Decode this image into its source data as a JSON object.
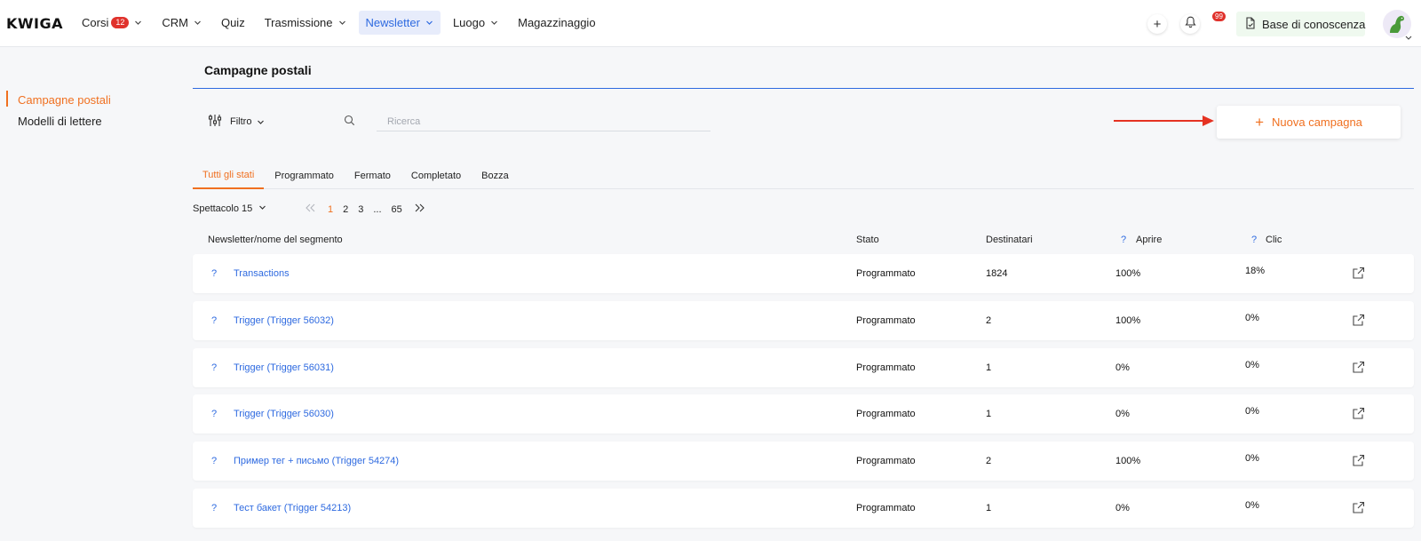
{
  "brand": {
    "logo": "KWIGA"
  },
  "nav": [
    {
      "label": "Corsi",
      "badge": "12",
      "has_dropdown": true,
      "active": false
    },
    {
      "label": "CRM",
      "badge": null,
      "has_dropdown": true,
      "active": false
    },
    {
      "label": "Quiz",
      "badge": null,
      "has_dropdown": false,
      "active": false
    },
    {
      "label": "Trasmissione",
      "badge": null,
      "has_dropdown": true,
      "active": false
    },
    {
      "label": "Newsletter",
      "badge": null,
      "has_dropdown": true,
      "active": true
    },
    {
      "label": "Luogo",
      "badge": null,
      "has_dropdown": true,
      "active": false
    },
    {
      "label": "Magazzinaggio",
      "badge": null,
      "has_dropdown": false,
      "active": false
    }
  ],
  "header_actions": {
    "add_label": "+",
    "notifications_badge": "99",
    "knowledge_base_label": "Base di conoscenza"
  },
  "sidebar": {
    "items": [
      {
        "label": "Campagne postali",
        "active": true
      },
      {
        "label": "Modelli di lettere",
        "active": false
      }
    ]
  },
  "page": {
    "title": "Campagne postali",
    "filter_label": "Filtro",
    "search_placeholder": "Ricerca",
    "search_value": "",
    "new_campaign_label": "Nuova campagna",
    "new_campaign_plus": "+"
  },
  "tabs": [
    {
      "label": "Tutti gli stati",
      "active": true
    },
    {
      "label": "Programmato",
      "active": false
    },
    {
      "label": "Fermato",
      "active": false
    },
    {
      "label": "Completato",
      "active": false
    },
    {
      "label": "Bozza",
      "active": false
    }
  ],
  "pagination": {
    "per_page_label": "Spettacolo 15",
    "pages": [
      {
        "label": "1",
        "active": true
      },
      {
        "label": "2",
        "active": false
      },
      {
        "label": "3",
        "active": false
      },
      {
        "label": "...",
        "active": false
      },
      {
        "label": "65",
        "active": false
      }
    ]
  },
  "table": {
    "columns": {
      "name": "Newsletter/nome del segmento",
      "status": "Stato",
      "recipients": "Destinatari",
      "open_help": "?",
      "open": "Aprire",
      "click_help": "?",
      "click": "Clic"
    },
    "rows": [
      {
        "help": "?",
        "name": "Transactions",
        "status": "Programmato",
        "recipients": "1824",
        "open": "100%",
        "click": "18%"
      },
      {
        "help": "?",
        "name": "Trigger (Trigger 56032)",
        "status": "Programmato",
        "recipients": "2",
        "open": "100%",
        "click": "0%"
      },
      {
        "help": "?",
        "name": "Trigger (Trigger 56031)",
        "status": "Programmato",
        "recipients": "1",
        "open": "0%",
        "click": "0%"
      },
      {
        "help": "?",
        "name": "Trigger (Trigger 56030)",
        "status": "Programmato",
        "recipients": "1",
        "open": "0%",
        "click": "0%"
      },
      {
        "help": "?",
        "name": "Пример тег + письмо (Trigger 54274)",
        "status": "Programmato",
        "recipients": "2",
        "open": "100%",
        "click": "0%"
      },
      {
        "help": "?",
        "name": "Тест бакет (Trigger 54213)",
        "status": "Programmato",
        "recipients": "1",
        "open": "0%",
        "click": "0%"
      }
    ]
  },
  "colors": {
    "accent_orange": "#f07020",
    "link_blue": "#2e6ae0",
    "badge_red": "#e0322c",
    "annotation_arrow": "#e53222"
  }
}
